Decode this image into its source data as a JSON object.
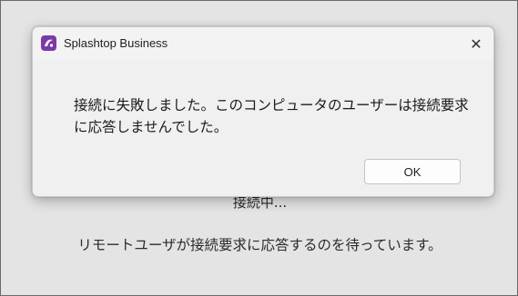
{
  "background": {
    "status_line1": "接続中...",
    "status_line2": "リモートユーザが接続要求に応答するのを待っています。"
  },
  "dialog": {
    "title": "Splashtop Business",
    "app_icon": "splashtop-logo-icon",
    "close_glyph": "✕",
    "message_line1": "接続に失敗しました。このコンピュータのユーザーは接続要求",
    "message_line2": "に応答しませんでした。",
    "ok_label": "OK"
  },
  "colors": {
    "brand": "#7b3aa4",
    "dialog_bg": "#f0f0f0",
    "window_bg": "#e4e4e4"
  }
}
